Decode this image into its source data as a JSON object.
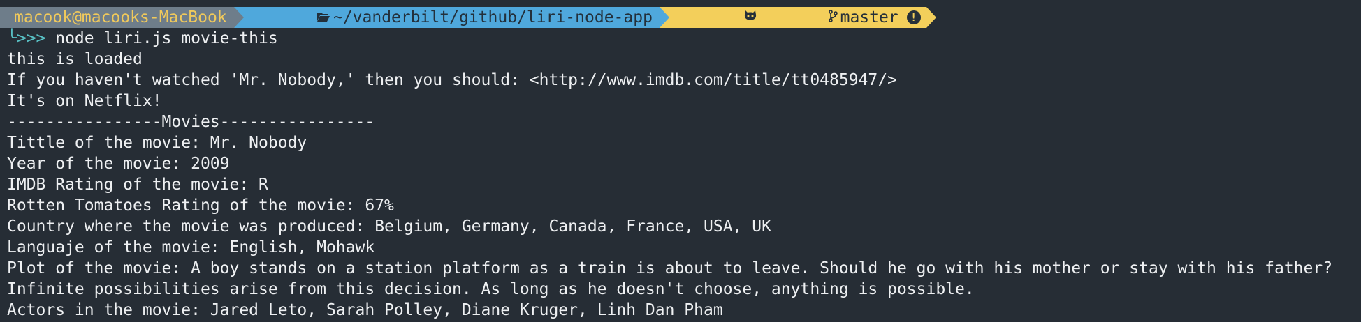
{
  "prompt": {
    "user_host": "macook@macooks-MacBook",
    "path": "~/vanderbilt/github/liri-node-app",
    "branch": "master",
    "prefix": "╰>>>",
    "command": " node liri.js movie-this"
  },
  "icons": {
    "folder": "folder-open-icon",
    "github": "github-cat-icon",
    "branch": "git-branch-icon",
    "warning": "exclamation-circle-icon"
  },
  "colors": {
    "background": "#262d35",
    "user_segment": "#6e7d8a",
    "user_text": "#f0c95b",
    "path_segment": "#4fa8dc",
    "git_segment": "#f3cf5b",
    "prompt_arrows": "#59c2c6"
  },
  "output": [
    "this is loaded",
    "If you haven't watched 'Mr. Nobody,' then you should: <http://www.imdb.com/title/tt0485947/>",
    "It's on Netflix!",
    "----------------Movies----------------",
    "Tittle of the movie: Mr. Nobody",
    "Year of the movie: 2009",
    "IMDB Rating of the movie: R",
    "Rotten Tomatoes Rating of the movie: 67%",
    "Country where the movie was produced: Belgium, Germany, Canada, France, USA, UK",
    "Languaje of the movie: English, Mohawk",
    "Plot of the movie: A boy stands on a station platform as a train is about to leave. Should he go with his mother or stay with his father?",
    "Infinite possibilities arise from this decision. As long as he doesn't choose, anything is possible.",
    "Actors in the movie: Jared Leto, Sarah Polley, Diane Kruger, Linh Dan Pham"
  ]
}
